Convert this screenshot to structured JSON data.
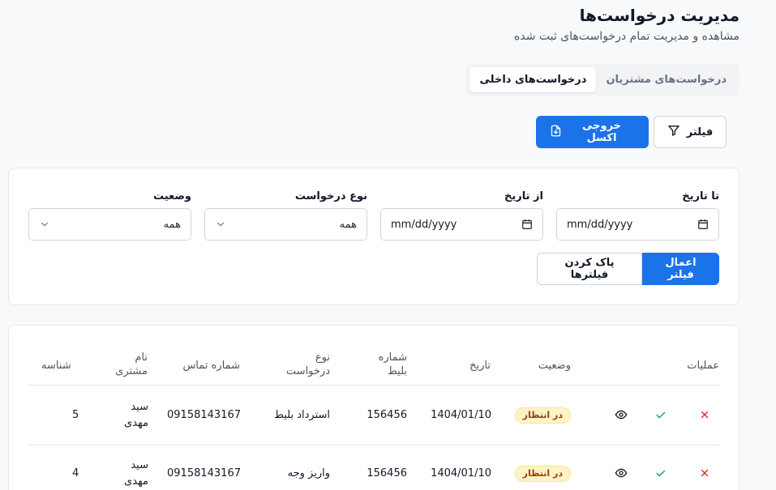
{
  "header": {
    "title": "مدیریت درخواست‌ها",
    "subtitle": "مشاهده و مدیریت تمام درخواست‌های ثبت شده"
  },
  "tabs": [
    {
      "label": "درخواست‌های مشتریان",
      "active": false
    },
    {
      "label": "درخواست‌های داخلی",
      "active": true
    }
  ],
  "toolbar": {
    "filter_label": "فیلتر",
    "export_label": "خروجی اکسل"
  },
  "filters": {
    "to_date": {
      "label": "تا تاریخ",
      "value": "mm/dd/yyyy"
    },
    "from_date": {
      "label": "از تاریخ",
      "value": "mm/dd/yyyy"
    },
    "request_type": {
      "label": "نوع درخواست",
      "value": "همه"
    },
    "status": {
      "label": "وضعیت",
      "value": "همه"
    },
    "apply_label": "اعمال فیلتر",
    "clear_label": "پاک کردن فیلترها"
  },
  "table": {
    "headers": {
      "id": "شناسه",
      "customer_name_1": "نام",
      "customer_name_2": "مشتری",
      "phone": "شماره تماس",
      "type_1": "نوع",
      "type_2": "درخواست",
      "ticket_1": "شماره",
      "ticket_2": "بلیط",
      "date": "تاریخ",
      "status": "وضعیت",
      "actions": "عملیات"
    },
    "rows": [
      {
        "id": "5",
        "name_1": "سید",
        "name_2": "مهدی",
        "phone": "09158143167",
        "type": "استرداد بلیط",
        "ticket": "156456",
        "date": "1404/01/10",
        "status": "در انتظار"
      },
      {
        "id": "4",
        "name_1": "سید",
        "name_2": "مهدی",
        "phone": "09158143167",
        "type": "واریز وجه",
        "ticket": "156456",
        "date": "1404/01/10",
        "status": "در انتظار"
      }
    ]
  },
  "colors": {
    "primary": "#1a73e8",
    "badge_bg": "#fef3c7",
    "badge_text": "#92400e",
    "approve": "#16a34a",
    "reject": "#dc2626"
  }
}
